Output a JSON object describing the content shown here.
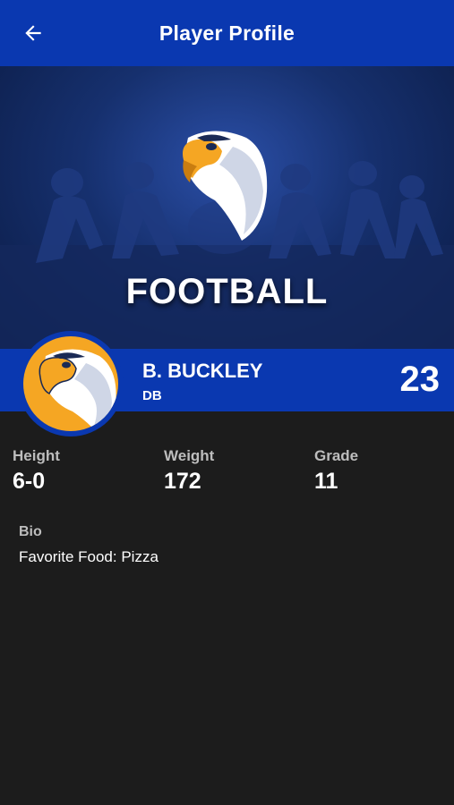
{
  "appbar": {
    "title": "Player Profile",
    "back_icon": "arrow-left-icon"
  },
  "banner": {
    "sport_title": "FOOTBALL",
    "logo_icon": "eagle-head-logo",
    "background_color": "#16306e"
  },
  "player": {
    "name": "B. BUCKLEY",
    "position": "DB",
    "number": "23",
    "avatar_icon": "eagle-head-logo",
    "avatar_color": "#f5a623"
  },
  "stats": [
    {
      "label": "Height",
      "value": "6-0"
    },
    {
      "label": "Weight",
      "value": "172"
    },
    {
      "label": "Grade",
      "value": "11"
    }
  ],
  "bio": {
    "title": "Bio",
    "text": "Favorite Food: Pizza"
  },
  "colors": {
    "primary_blue": "#0a38b0",
    "background": "#1c1c1c",
    "accent_orange": "#f5a623"
  }
}
